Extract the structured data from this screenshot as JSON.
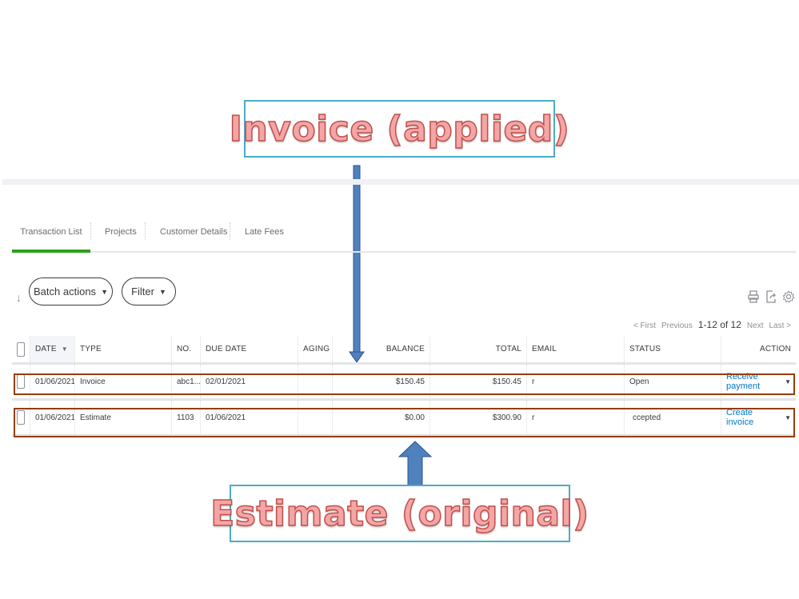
{
  "annotations": {
    "top_callout": "Invoice (applied)",
    "bottom_callout": "Estimate (original)",
    "highlight_color": "#953d05",
    "callout_border_color": "#4bacc6",
    "arrow_color": "#4f81bd"
  },
  "tabs": [
    {
      "label": "Transaction List",
      "active": true
    },
    {
      "label": "Projects",
      "active": false
    },
    {
      "label": "Customer Details",
      "active": false
    },
    {
      "label": "Late Fees",
      "active": false
    }
  ],
  "toolbar": {
    "batch_actions": "Batch actions",
    "filter": "Filter",
    "icons": [
      "print-icon",
      "export-icon",
      "settings-icon"
    ]
  },
  "pager": {
    "first": "< First",
    "previous": "Previous",
    "count": "1-12 of 12",
    "next": "Next",
    "last": "Last >"
  },
  "table": {
    "columns": [
      "DATE",
      "TYPE",
      "NO.",
      "DUE DATE",
      "AGING",
      "BALANCE",
      "TOTAL",
      "EMAIL",
      "STATUS",
      "ACTION"
    ],
    "sort_indicator": "▼",
    "rows": [
      {
        "date": "01/06/2021",
        "type": "Invoice",
        "no": "abc1...",
        "due_date": "02/01/2021",
        "aging": "",
        "balance": "$150.45",
        "total": "$150.45",
        "email": "r",
        "status": "Open",
        "action": "Receive payment"
      },
      {
        "date": "01/06/2021",
        "type": "Estimate",
        "no": "1103",
        "due_date": "01/06/2021",
        "aging": "",
        "balance": "$0.00",
        "total": "$300.90",
        "email": "r",
        "status": "ccepted",
        "action": "Create invoice"
      }
    ]
  },
  "accent_color": "#2ca01c",
  "link_color": "#0077c5"
}
